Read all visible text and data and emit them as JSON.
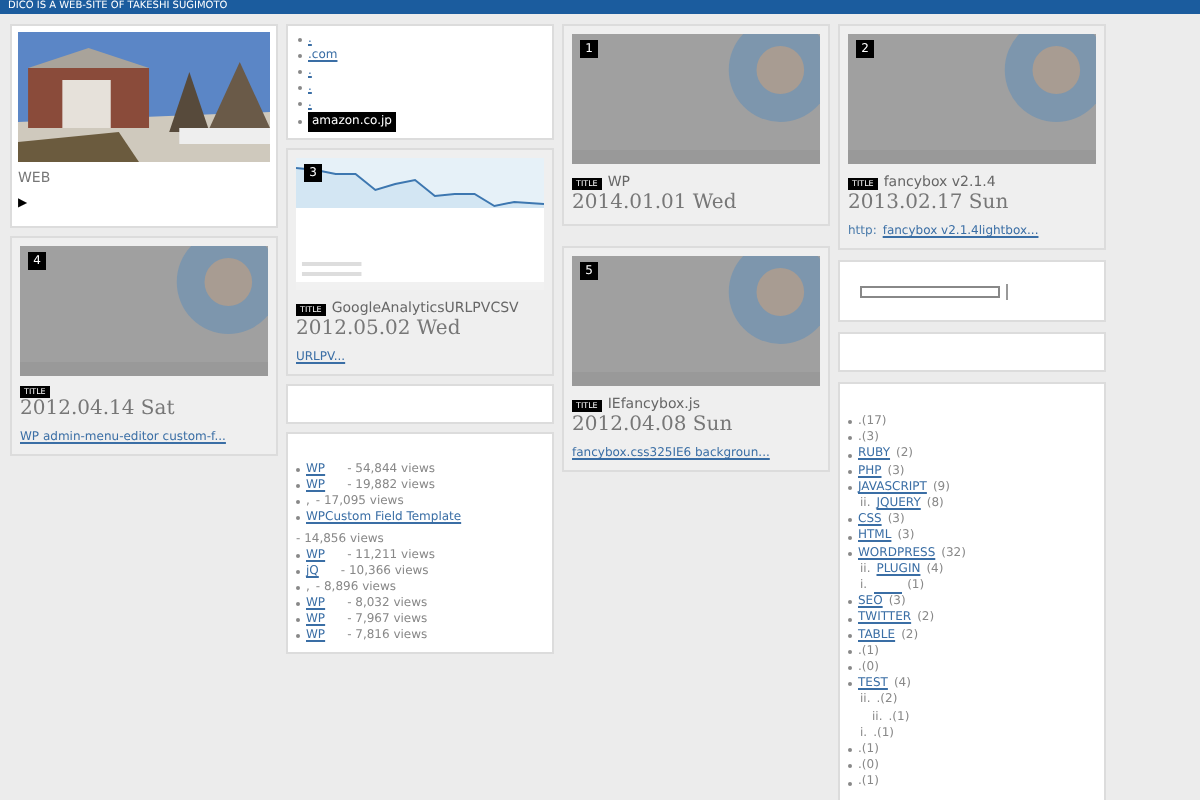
{
  "header": {
    "tagline": "DICO IS A WEB-SITE OF TAKESHI SUGIMOTO"
  },
  "about": {
    "kind": "picture",
    "caption": "WEB",
    "more": "▶"
  },
  "links": {
    "items": [
      ".",
      ".com",
      ".",
      ".",
      "."
    ],
    "logo": "amazon.co.jp"
  },
  "columns": [
    {
      "posts": [
        {
          "number": "4",
          "kind": "thumb",
          "badge": "TITLE",
          "date": "2012.04.14 Sat",
          "excerpt": "WP admin-menu-editor custom-f..."
        }
      ]
    },
    {
      "posts": [
        {
          "number": "3",
          "kind": "chart",
          "badge": "TITLE",
          "title": "GoogleAnalyticsURLPVCSV",
          "date": "2012.05.02 Wed",
          "excerpt": "URLPV..."
        }
      ]
    },
    {
      "posts": [
        {
          "number": "1",
          "kind": "thumb",
          "badge": "TITLE",
          "title": "WP",
          "date": "2014.01.01 Wed"
        },
        {
          "number": "5",
          "kind": "thumb",
          "badge": "TITLE",
          "title": "IEfancybox.js",
          "date": "2012.04.08 Sun",
          "excerpt": "fancybox.css325IE6 backgroun..."
        }
      ]
    },
    {
      "posts": [
        {
          "number": "2",
          "kind": "thumb",
          "badge": "TITLE",
          "title": "fancybox v2.1.4",
          "date": "2013.02.17 Sun",
          "prefix": "http:",
          "excerpt": "fancybox v2.1.4lightbox..."
        }
      ]
    }
  ],
  "popular": [
    {
      "kind": "link",
      "title": "WP",
      "views": "- 54,844 views"
    },
    {
      "kind": "link",
      "title": "WP",
      "views": "- 19,882 views"
    },
    {
      "kind": "plain",
      "title": ",",
      "views": "- 17,095 views"
    },
    {
      "kind": "link",
      "title": "WPCustom Field Template",
      "views": "- 14,856 views"
    },
    {
      "kind": "link",
      "title": "WP",
      "views": "- 11,211 views"
    },
    {
      "kind": "link",
      "title": "jQ",
      "views": "- 10,366 views"
    },
    {
      "kind": "plain",
      "title": ",",
      "views": "- 8,896 views"
    },
    {
      "kind": "link",
      "title": "WP",
      "views": "- 8,032 views"
    },
    {
      "kind": "link",
      "title": "WP",
      "views": "- 7,967 views"
    },
    {
      "kind": "link",
      "title": "WP",
      "views": "- 7,816 views"
    }
  ],
  "categories": [
    {
      "text": ".(17)"
    },
    {
      "text": ".(3)"
    },
    {
      "label": "RUBY",
      "count": "(2)"
    },
    {
      "label": "PHP",
      "count": "(3)"
    },
    {
      "label": "JAVASCRIPT",
      "count": "(9)",
      "children": [
        {
          "marker": "ii.",
          "label": "JQUERY",
          "count": "(8)"
        }
      ]
    },
    {
      "label": "CSS",
      "count": "(3)"
    },
    {
      "label": "HTML",
      "count": "(3)"
    },
    {
      "label": "WORDPRESS",
      "count": "(32)",
      "children": [
        {
          "marker": "ii.",
          "label": "PLUGIN",
          "count": "(4)"
        },
        {
          "marker": "i.",
          "count": "(1)"
        }
      ]
    },
    {
      "label": "SEO",
      "count": "(3)"
    },
    {
      "label": "TWITTER",
      "count": "(2)"
    },
    {
      "label": "TABLE",
      "count": "(2)"
    },
    {
      "text": ".(1)"
    },
    {
      "text": ".(0)"
    },
    {
      "label": "TEST",
      "count": "(4)",
      "children": [
        {
          "marker": "ii.",
          "text": ".(2)",
          "children": [
            {
              "marker": "ii.",
              "text": ".(1)"
            }
          ]
        },
        {
          "marker": "i.",
          "text": ".(1)"
        }
      ]
    },
    {
      "text": ".(1)"
    },
    {
      "text": ".(0)"
    },
    {
      "text": ".(1)"
    }
  ]
}
